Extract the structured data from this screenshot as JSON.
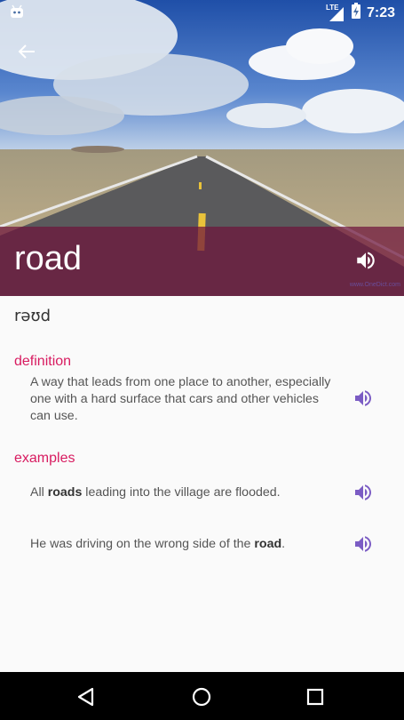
{
  "status_bar": {
    "network": "LTE",
    "time": "7:23"
  },
  "icons": {
    "back": "arrow-left-icon",
    "speak": "volume-up-icon",
    "android": "android-icon",
    "battery": "battery-charging-icon",
    "signal": "cell-signal-icon"
  },
  "word": {
    "title": "road",
    "credit": "www.OneDict.com",
    "phonetic": "rəʊd"
  },
  "definition": {
    "label": "definition",
    "text": "A way that leads from one place to another, especially one with a hard surface that cars and other vehicles can use."
  },
  "examples": {
    "label": "examples",
    "items": [
      {
        "before": "All ",
        "bold": "roads",
        "after": " leading into the village are flooded."
      },
      {
        "before": "He was driving on the wrong side of the ",
        "bold": "road",
        "after": "."
      }
    ]
  },
  "colors": {
    "accent": "#d81b60",
    "speaker": "#7b5cc4",
    "overlay": "#6e143c"
  }
}
